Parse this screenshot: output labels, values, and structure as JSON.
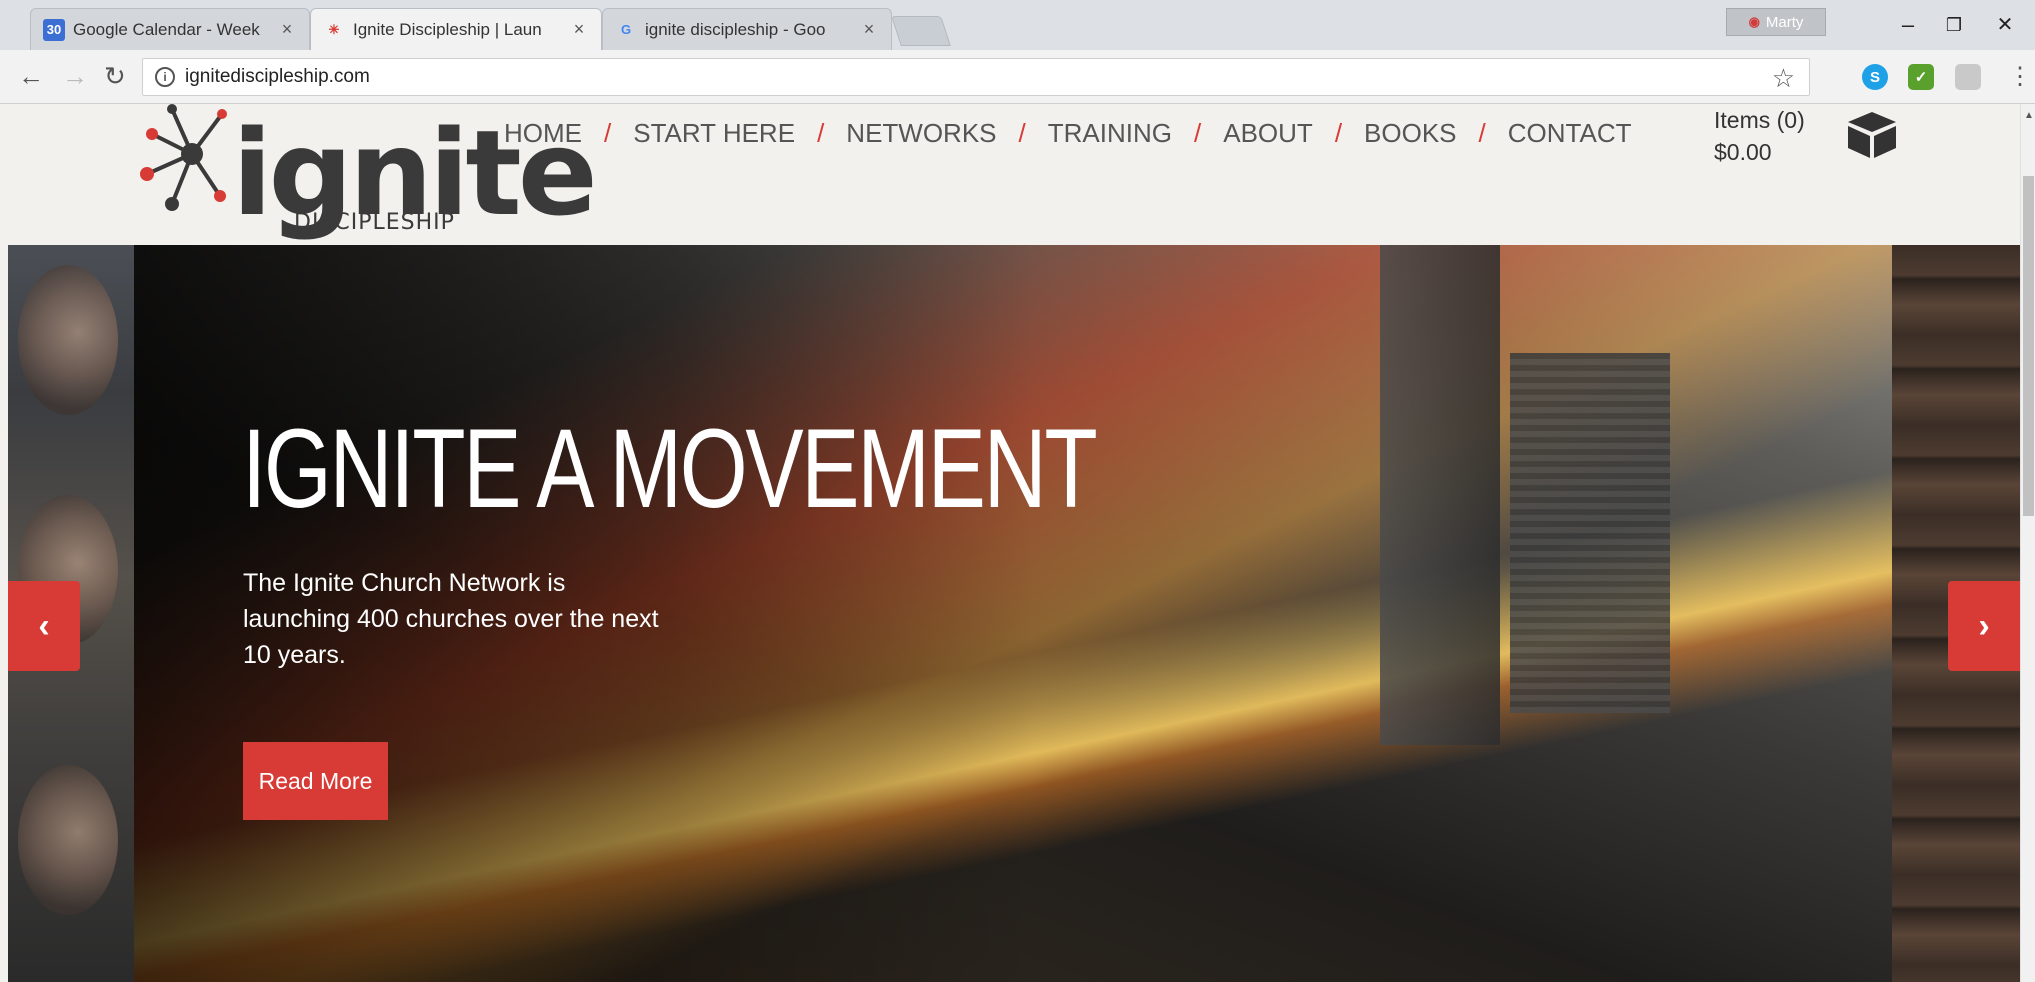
{
  "browser": {
    "tabs": [
      {
        "favicon": "30",
        "title": "Google Calendar - Week",
        "close": "×"
      },
      {
        "favicon": "✳",
        "title": "Ignite Discipleship | Laun",
        "close": "×"
      },
      {
        "favicon": "G",
        "title": "ignite discipleship - Goo",
        "close": "×"
      }
    ],
    "profile": "Marty",
    "url": "ignitediscipleship.com",
    "window": {
      "minimize": "–",
      "restore": "❐",
      "close": "✕"
    }
  },
  "site": {
    "logo": {
      "word": "ignite",
      "sub": "DISCIPLESHIP"
    },
    "nav": [
      "HOME",
      "START HERE",
      "NETWORKS",
      "TRAINING",
      "ABOUT",
      "BOOKS",
      "CONTACT"
    ],
    "nav_separator": "/",
    "cart": {
      "items": "Items (0)",
      "total": "$0.00"
    }
  },
  "hero": {
    "title": "IGNITE A MOVEMENT",
    "text": "The Ignite Church Network is launching 400 churches over the next 10 years.",
    "button": "Read More",
    "prev": "‹",
    "next": "›"
  },
  "colors": {
    "accent": "#d83a35",
    "header_bg": "#f2f1ee",
    "text": "#555555"
  }
}
